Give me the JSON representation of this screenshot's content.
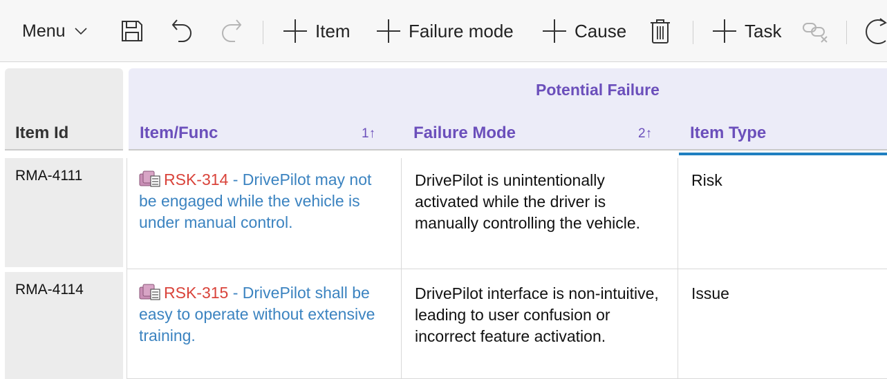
{
  "toolbar": {
    "menu_label": "Menu",
    "add_item_label": "Item",
    "add_failure_mode_label": "Failure mode",
    "add_cause_label": "Cause",
    "add_task_label": "Task"
  },
  "grid": {
    "group_title": "Potential Failure",
    "columns": {
      "item_id": "Item Id",
      "item_func": "Item/Func",
      "item_func_sort": "1",
      "failure_mode": "Failure Mode",
      "failure_mode_sort": "2",
      "item_type": "Item Type"
    },
    "rows": [
      {
        "item_id": "RMA-4111",
        "func_id": "RSK-314",
        "func_text": " - DrivePilot may not be engaged while the vehicle is under manual control.",
        "failure_mode": "DrivePilot is unintentionally activated while the driver is manually controlling the vehicle.",
        "item_type": "Risk"
      },
      {
        "item_id": "RMA-4114",
        "func_id": "RSK-315",
        "func_text": " - DrivePilot shall be easy to operate without extensive training.",
        "failure_mode": "DrivePilot interface is non-intuitive, leading to user confusion or incorrect feature activation.",
        "item_type": "Issue"
      }
    ]
  },
  "colors": {
    "header_accent": "#6b4fbb",
    "link": "#3b83c0",
    "risk_id": "#d9433a",
    "active_column": "#1f7fc0"
  },
  "icons": [
    "chevron-down-icon",
    "save-icon",
    "undo-icon",
    "redo-icon",
    "plus-icon",
    "trash-icon",
    "unlink-icon",
    "refresh-icon",
    "risk-item-icon",
    "sort-ascending-icon"
  ]
}
